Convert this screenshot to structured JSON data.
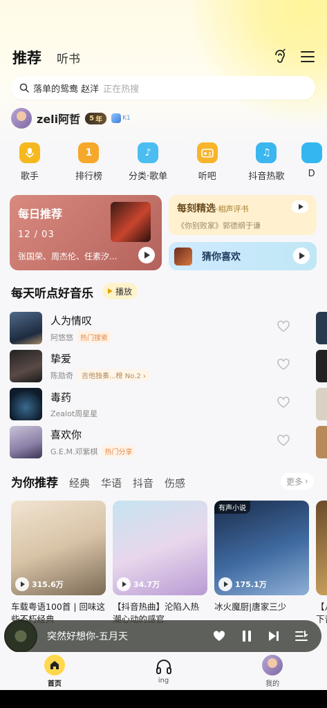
{
  "header": {
    "tab_active": "推荐",
    "tab_other": "听书"
  },
  "search": {
    "query": "落单的鸳鸯 赵洋",
    "hint": "正在热搜"
  },
  "user": {
    "name": "zeli阿哲",
    "vip_level": "5",
    "vip_suffix": "年",
    "level": "K1"
  },
  "categories": [
    {
      "label": "歌手",
      "icon": "mic-icon",
      "color": "#f5b81e"
    },
    {
      "label": "排行榜",
      "icon": "rank-icon",
      "color": "#f6a82a"
    },
    {
      "label": "分类·歌单",
      "icon": "music-note-icon",
      "color": "#4cbdf0"
    },
    {
      "label": "听吧",
      "icon": "radio-icon",
      "color": "#f7b52b"
    },
    {
      "label": "抖音热歌",
      "icon": "tiktok-note-icon",
      "color": "#3bb6ee"
    },
    {
      "label": "D",
      "icon": "partial-icon",
      "color": "#34b7f0"
    }
  ],
  "daily": {
    "title": "每日推荐",
    "date": "12 / 03",
    "subtitle": "张国荣、周杰伦、任素汐..."
  },
  "moment": {
    "title": "每刻精选",
    "title_suffix": "·相声评书",
    "subtitle": "《你别败家》郭德纲于谦"
  },
  "guess": {
    "title": "猜你喜欢"
  },
  "section_daily_music": {
    "title": "每天听点好音乐",
    "play_label": "播放",
    "songs": [
      {
        "name": "人为情叹",
        "artist": "阿悠悠",
        "tag": "热门搜索"
      },
      {
        "name": "挚爱",
        "artist": "陈勋奇",
        "tag": "吉他独奏...榜 No.2"
      },
      {
        "name": "毒药",
        "artist": "Zealot周星星",
        "tag": ""
      },
      {
        "name": "喜欢你",
        "artist": "G.E.M.邓紫棋",
        "tag": "热门分享"
      }
    ]
  },
  "section_recommend": {
    "tabs": [
      "为你推荐",
      "经典",
      "华语",
      "抖音",
      "伤感"
    ],
    "more_label": "更多",
    "playlists": [
      {
        "title": "车载粤语100首 | 回味这些不朽经典",
        "play_count": "315.6万",
        "badge": ""
      },
      {
        "title": "【抖音热曲】沦陷入热潮心动的感官",
        "play_count": "34.7万",
        "badge": ""
      },
      {
        "title": "冰火魔厨|唐家三少",
        "play_count": "175.1万",
        "badge": "有声小说"
      },
      {
        "title": "【八下音",
        "play_count": "",
        "badge": ""
      }
    ]
  },
  "player": {
    "now_playing": "突然好想你-五月天"
  },
  "bottom_nav": [
    {
      "label": "首页",
      "active": true
    },
    {
      "label": "ing",
      "active": false
    },
    {
      "label": "我的",
      "active": false
    }
  ],
  "colors": {
    "accent_yellow": "#ffd84d",
    "tag_orange": "#e38a4a"
  }
}
